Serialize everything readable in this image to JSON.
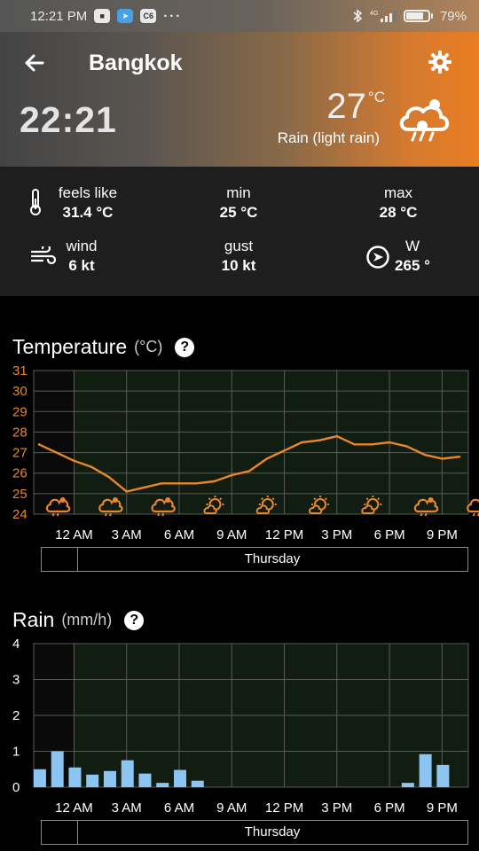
{
  "status_bar": {
    "time": "12:21 PM",
    "network": "4G",
    "battery": "79%",
    "battery_level": 0.79
  },
  "header": {
    "city": "Bangkok",
    "local_time": "22:21",
    "temperature": "27",
    "temperature_unit": "°C",
    "condition": "Rain (light rain)",
    "condition_icon": "cloud-rain-icon"
  },
  "details": {
    "feels_like": {
      "label": "feels like",
      "value": "31.4 °C"
    },
    "min": {
      "label": "min",
      "value": "25 °C"
    },
    "max": {
      "label": "max",
      "value": "28 °C"
    },
    "wind": {
      "label": "wind",
      "value": "6 kt"
    },
    "gust": {
      "label": "gust",
      "value": "10 kt"
    },
    "direction": {
      "label": "W",
      "value": "265 °"
    }
  },
  "temperature_section": {
    "title": "Temperature",
    "unit": "(°C)",
    "help": "?",
    "day_label": "Thursday"
  },
  "rain_section": {
    "title": "Rain",
    "unit": "(mm/h)",
    "help": "?",
    "day_label": "Thursday"
  },
  "colors": {
    "temp_line": "#e8872a",
    "temp_axis_labels": "#e8872a",
    "rain_bar": "#8cc4f2",
    "grid": "#5a5a5a",
    "plot_bg": "#121d12"
  },
  "chart_data": [
    {
      "type": "line",
      "ylim": [
        24,
        31
      ],
      "yticks": [
        24,
        25,
        26,
        27,
        28,
        29,
        30,
        31
      ],
      "xtick_labels": [
        "12 AM",
        "3 AM",
        "6 AM",
        "9 AM",
        "12 PM",
        "3 PM",
        "6 PM",
        "9 PM"
      ],
      "x_hours": [
        -2,
        -1,
        0,
        1,
        2,
        3,
        4,
        5,
        6,
        7,
        8,
        9,
        10,
        11,
        12,
        13,
        14,
        15,
        16,
        17,
        18,
        19,
        20,
        21,
        22
      ],
      "values": [
        27.4,
        27.0,
        26.6,
        26.3,
        25.8,
        25.1,
        25.3,
        25.5,
        25.5,
        25.5,
        25.6,
        25.9,
        26.1,
        26.7,
        27.1,
        27.5,
        27.6,
        27.8,
        27.4,
        27.4,
        27.5,
        27.3,
        26.9,
        26.7,
        26.8
      ],
      "weather_icons": [
        "cloud-rain-icon",
        "cloud-rain-icon",
        "cloud-rain-icon",
        "cloud-sun-rain-icon",
        "sun-cloud-icon",
        "sun-cloud-icon",
        "sun-cloud-icon",
        "cloud-rain-icon",
        "cloud-rain-icon"
      ],
      "grid": true
    },
    {
      "type": "bar",
      "ylim": [
        0,
        4
      ],
      "yticks": [
        0,
        1,
        2,
        3,
        4
      ],
      "xtick_labels": [
        "12 AM",
        "3 AM",
        "6 AM",
        "9 AM",
        "12 PM",
        "3 PM",
        "6 PM",
        "9 PM"
      ],
      "x_hours": [
        -2,
        -1,
        0,
        1,
        2,
        3,
        4,
        5,
        6,
        7,
        8,
        9,
        10,
        11,
        12,
        13,
        14,
        15,
        16,
        17,
        18,
        19,
        20,
        21,
        22
      ],
      "values": [
        0.5,
        1.0,
        0.55,
        0.35,
        0.45,
        0.75,
        0.38,
        0.12,
        0.48,
        0.18,
        0,
        0,
        0,
        0,
        0,
        0,
        0,
        0,
        0,
        0,
        0,
        0.12,
        0.92,
        0.62,
        0
      ],
      "grid": true
    }
  ]
}
